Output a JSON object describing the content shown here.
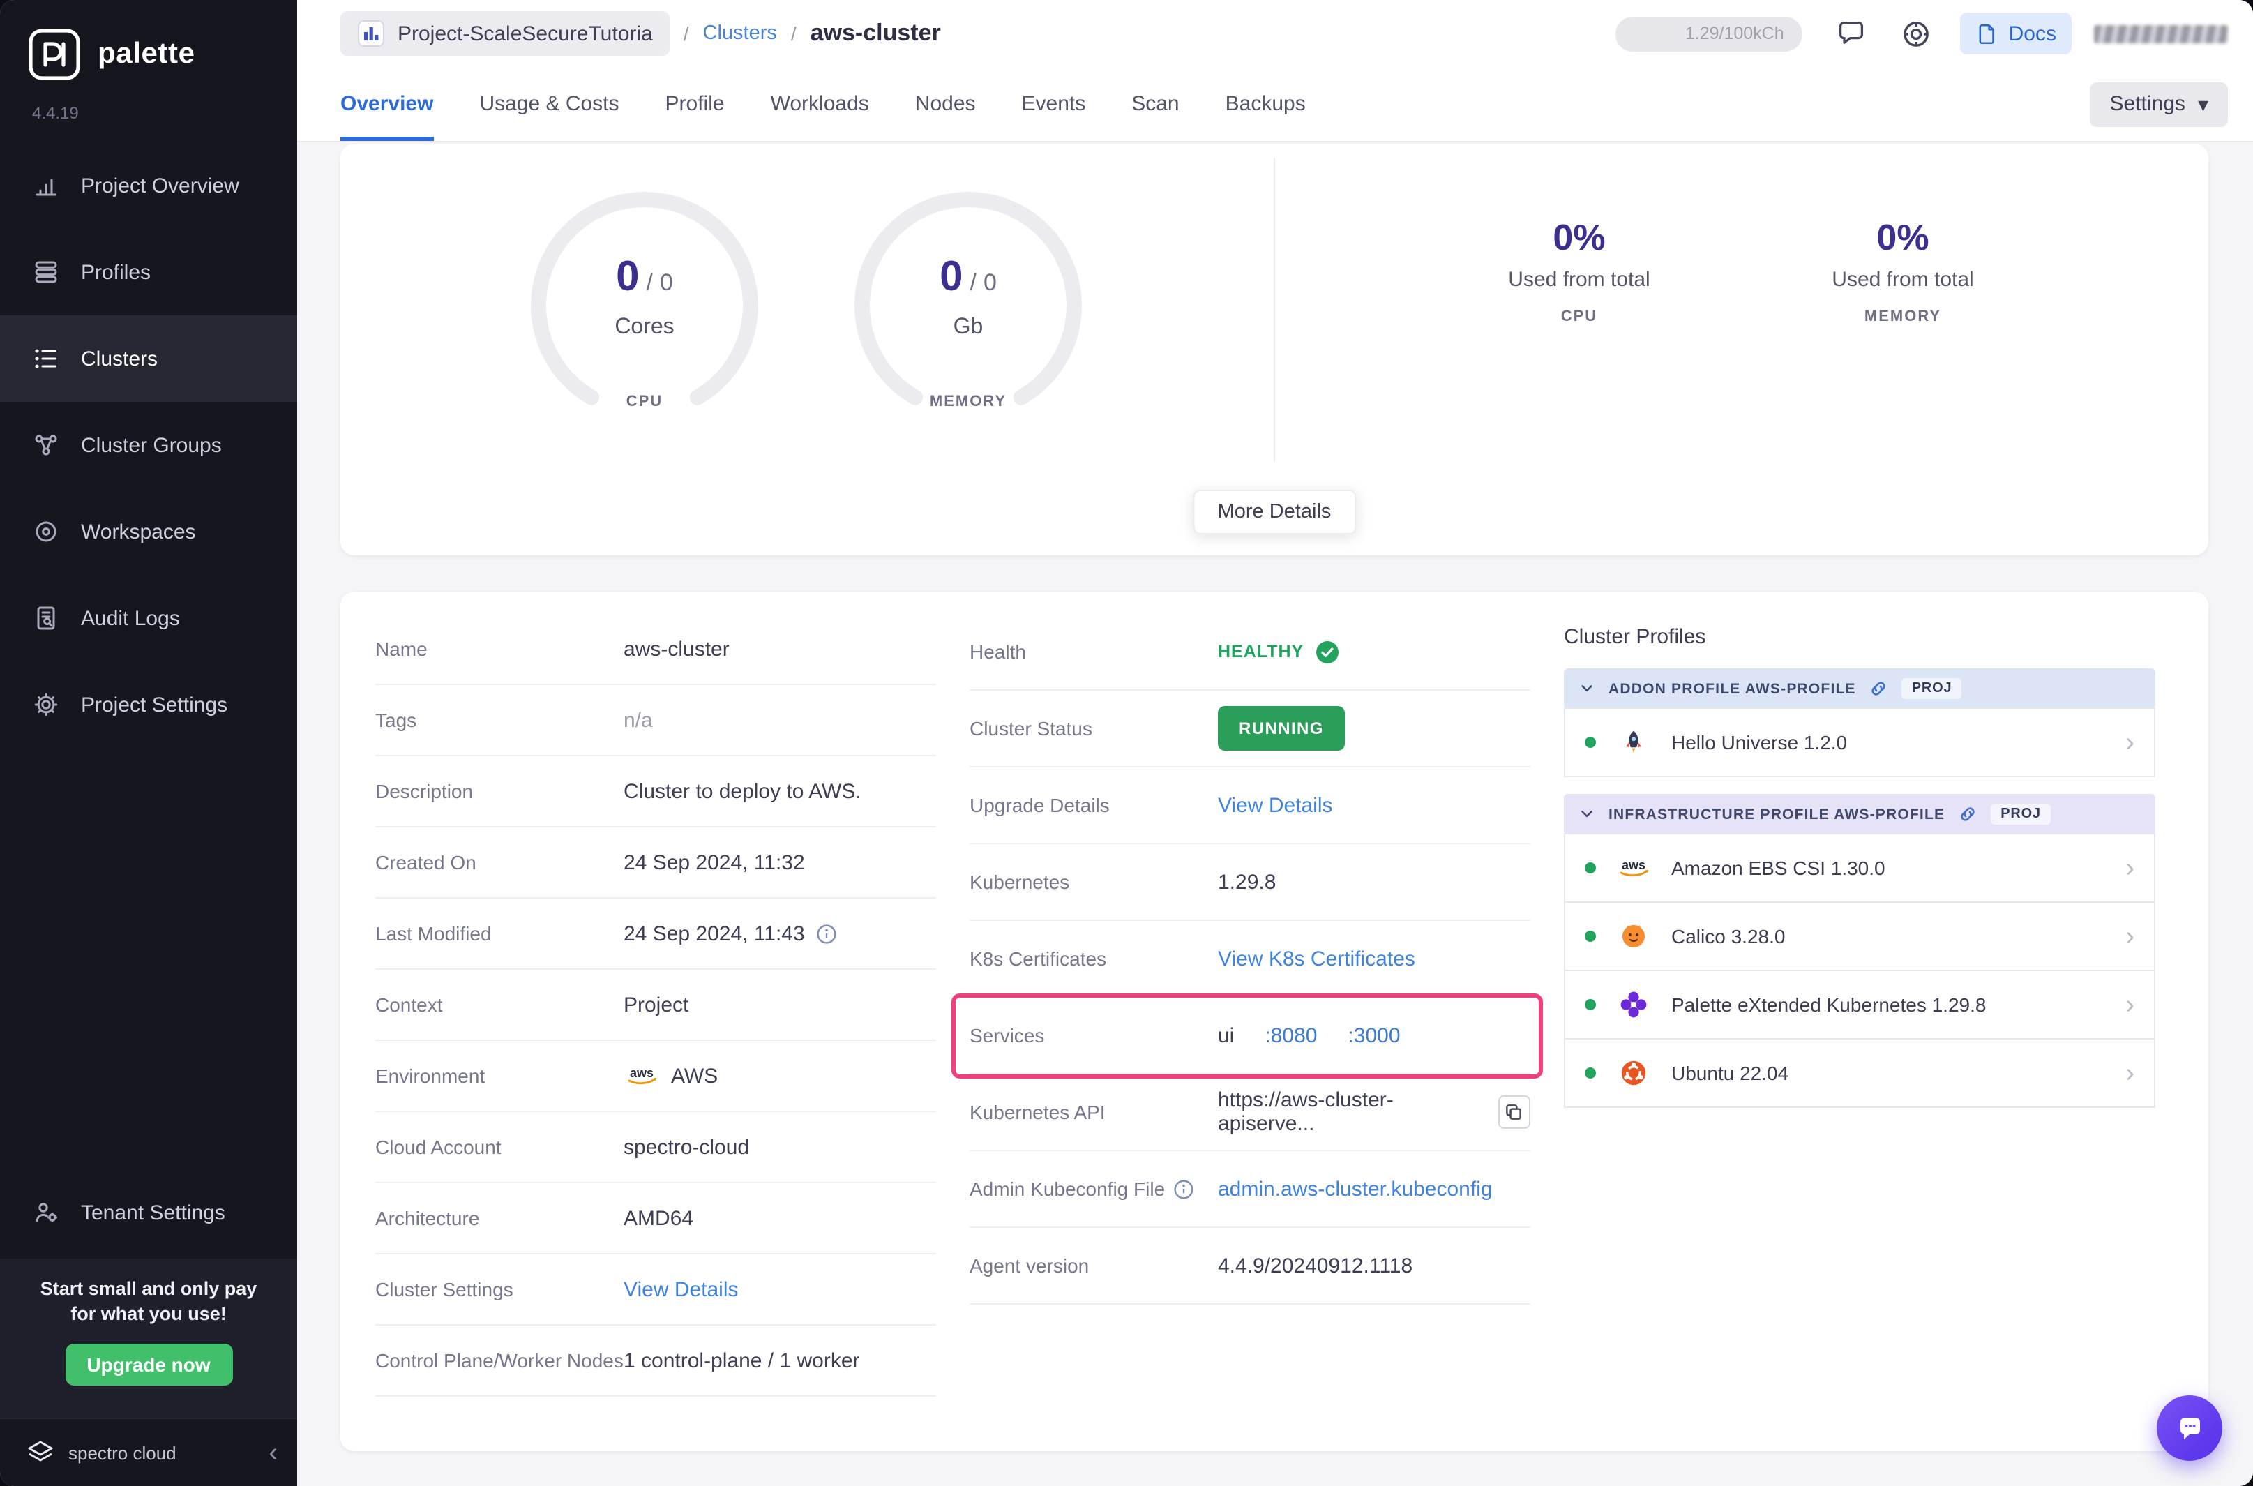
{
  "colors": {
    "accent_blue": "#2d6bd9",
    "link_blue": "#3f83e0",
    "success_green": "#23a45d",
    "annotation_pink": "#f2407a",
    "sidebar_bg": "#16161f",
    "metric_indigo": "#3b2f8f"
  },
  "sidebar": {
    "brand": "palette",
    "version": "4.4.19",
    "items": [
      {
        "label": "Project Overview"
      },
      {
        "label": "Profiles"
      },
      {
        "label": "Clusters"
      },
      {
        "label": "Cluster Groups"
      },
      {
        "label": "Workspaces"
      },
      {
        "label": "Audit Logs"
      },
      {
        "label": "Project Settings"
      }
    ],
    "tenant": {
      "label": "Tenant Settings"
    },
    "promo": {
      "line1": "Start small and only pay",
      "line2": "for what you use!",
      "button": "Upgrade now"
    },
    "footer": {
      "brand": "spectro cloud"
    }
  },
  "header": {
    "project": "Project-ScaleSecureTutoria",
    "sep1": "/",
    "clusters_link": "Clusters",
    "sep2": "/",
    "current": "aws-cluster",
    "usage": "1.29/100kCh",
    "docs": "Docs"
  },
  "tabs": {
    "items": [
      "Overview",
      "Usage & Costs",
      "Profile",
      "Workloads",
      "Nodes",
      "Events",
      "Scan",
      "Backups"
    ],
    "settings": "Settings"
  },
  "metrics": {
    "cpu": {
      "value": "0",
      "sep": "/",
      "total": "0",
      "unit": "Cores",
      "caption": "CPU"
    },
    "memory": {
      "value": "0",
      "sep": "/",
      "total": "0",
      "unit": "Gb",
      "caption": "MEMORY"
    },
    "cpu_usage": {
      "percent": "0%",
      "text": "Used from total",
      "caption": "CPU"
    },
    "memory_usage": {
      "percent": "0%",
      "text": "Used from total",
      "caption": "MEMORY"
    },
    "more_details": "More Details"
  },
  "details": {
    "left": [
      {
        "key": "Name",
        "value": "aws-cluster"
      },
      {
        "key": "Tags",
        "value": "n/a"
      },
      {
        "key": "Description",
        "value": "Cluster to deploy to AWS."
      },
      {
        "key": "Created On",
        "value": "24 Sep 2024, 11:32"
      },
      {
        "key": "Last Modified",
        "value": "24 Sep 2024, 11:43"
      },
      {
        "key": "Context",
        "value": "Project"
      },
      {
        "key": "Environment",
        "value": "AWS"
      },
      {
        "key": "Cloud Account",
        "value": "spectro-cloud"
      },
      {
        "key": "Architecture",
        "value": "AMD64"
      },
      {
        "key": "Cluster Settings",
        "value": "View Details"
      },
      {
        "key": "Control Plane/Worker Nodes",
        "value": "1 control-plane / 1 worker"
      }
    ],
    "middle": {
      "health_key": "Health",
      "health_value": "HEALTHY",
      "status_key": "Cluster Status",
      "status_value": "RUNNING",
      "upgrade_key": "Upgrade Details",
      "upgrade_value": "View Details",
      "k8s_key": "Kubernetes",
      "k8s_value": "1.29.8",
      "cert_key": "K8s Certificates",
      "cert_value": "View K8s Certificates",
      "services_key": "Services",
      "services_name": "ui",
      "services_port1": ":8080",
      "services_port2": ":3000",
      "api_key": "Kubernetes API",
      "api_value": "https://aws-cluster-apiserve...",
      "kubeconfig_key": "Admin Kubeconfig File",
      "kubeconfig_value": "admin.aws-cluster.kubeconfig",
      "agent_key": "Agent version",
      "agent_value": "4.4.9/20240912.1118"
    }
  },
  "profiles": {
    "title": "Cluster Profiles",
    "sections": [
      {
        "title": "ADDON PROFILE AWS-PROFILE",
        "badge": "PROJ",
        "items": [
          {
            "name": "Hello Universe 1.2.0"
          }
        ]
      },
      {
        "title": "INFRASTRUCTURE PROFILE AWS-PROFILE",
        "badge": "PROJ",
        "items": [
          {
            "name": "Amazon EBS CSI 1.30.0"
          },
          {
            "name": "Calico 3.28.0"
          },
          {
            "name": "Palette eXtended Kubernetes 1.29.8"
          },
          {
            "name": "Ubuntu 22.04"
          }
        ]
      }
    ]
  }
}
